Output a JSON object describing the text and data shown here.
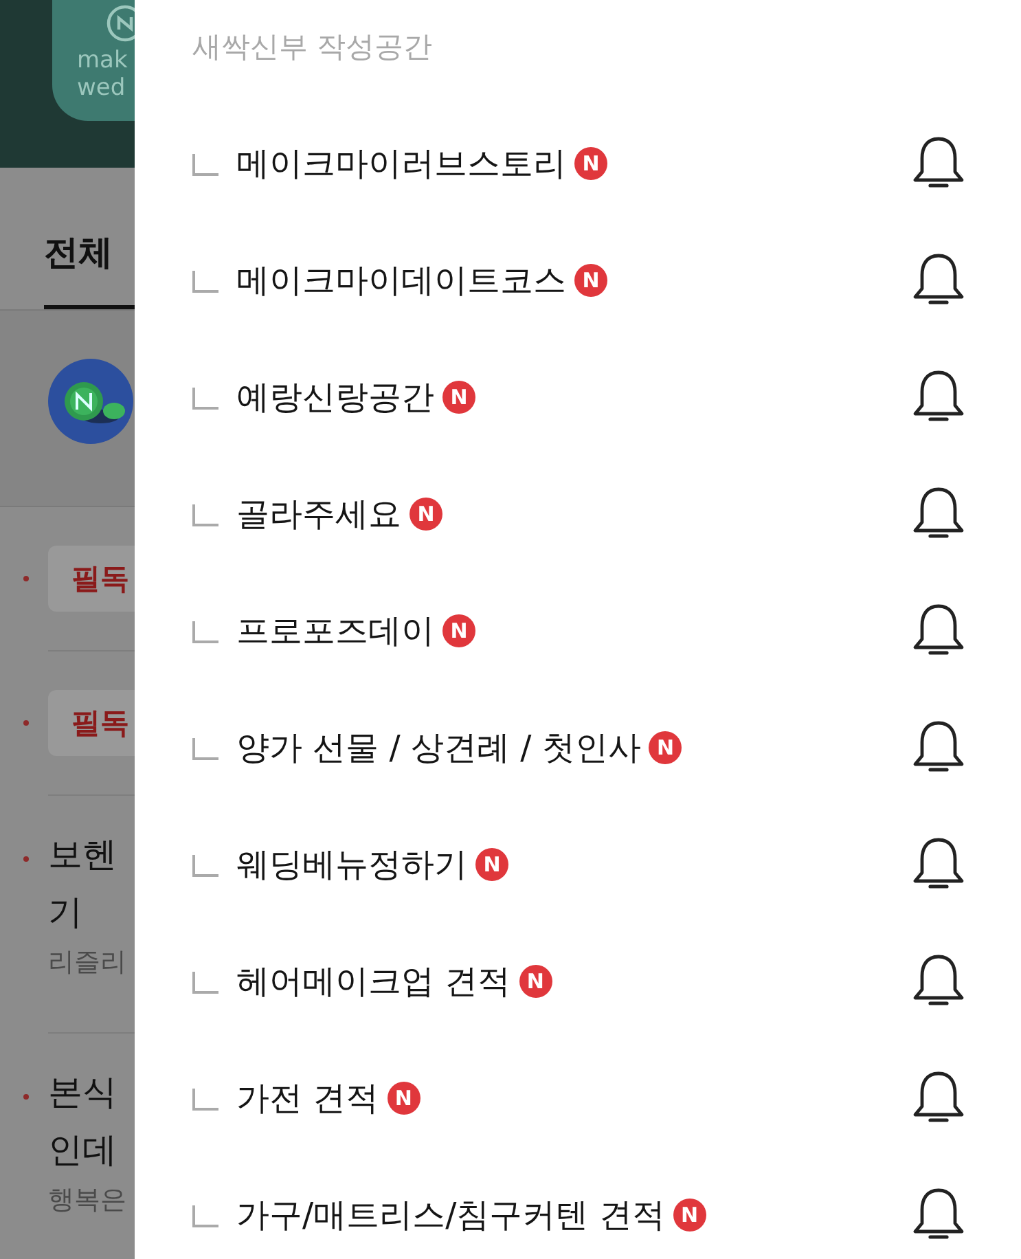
{
  "background": {
    "logo_lines": [
      "mak",
      "wed"
    ],
    "tab": {
      "label": "전체",
      "selected": true
    },
    "posts": [
      {
        "kind": "notice",
        "tag": "필독"
      },
      {
        "kind": "notice",
        "tag": "필독"
      },
      {
        "kind": "post",
        "title_lines": [
          "보헨",
          "기"
        ],
        "author": "리즐리"
      },
      {
        "kind": "post",
        "title_lines": [
          "본식",
          "인데"
        ],
        "author": "행복은"
      }
    ]
  },
  "drawer": {
    "section_title": "새싹신부 작성공간",
    "boards": [
      {
        "name": "메이크마이러브스토리",
        "badge": "N",
        "subscribed": false
      },
      {
        "name": "메이크마이데이트코스",
        "badge": "N",
        "subscribed": false
      },
      {
        "name": "예랑신랑공간",
        "badge": "N",
        "subscribed": false
      },
      {
        "name": "골라주세요",
        "badge": "N",
        "subscribed": false
      },
      {
        "name": "프로포즈데이",
        "badge": "N",
        "subscribed": false
      },
      {
        "name": "양가 선물 / 상견례 / 첫인사",
        "badge": "N",
        "subscribed": false
      },
      {
        "name": "웨딩베뉴정하기",
        "badge": "N",
        "subscribed": false
      },
      {
        "name": "헤어메이크업 견적",
        "badge": "N",
        "subscribed": false
      },
      {
        "name": "가전 견적",
        "badge": "N",
        "subscribed": false
      },
      {
        "name": "가구/매트리스/침구커텐 견적",
        "badge": "N",
        "subscribed": false
      }
    ]
  }
}
